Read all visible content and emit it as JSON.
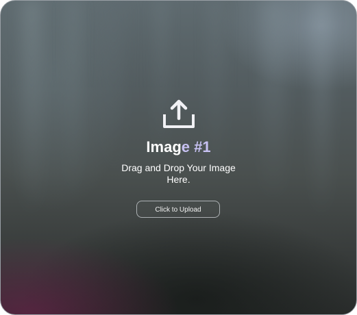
{
  "upload_card": {
    "icon": "upload-icon",
    "title_main": "Imag",
    "title_accent": "e #1",
    "subtitle": "Drag and Drop Your Image Here.",
    "button_label": "Click to Upload"
  },
  "colors": {
    "title": "#ffffff",
    "title_accent": "#c7c1f2",
    "button_border": "#e6ebf0"
  }
}
